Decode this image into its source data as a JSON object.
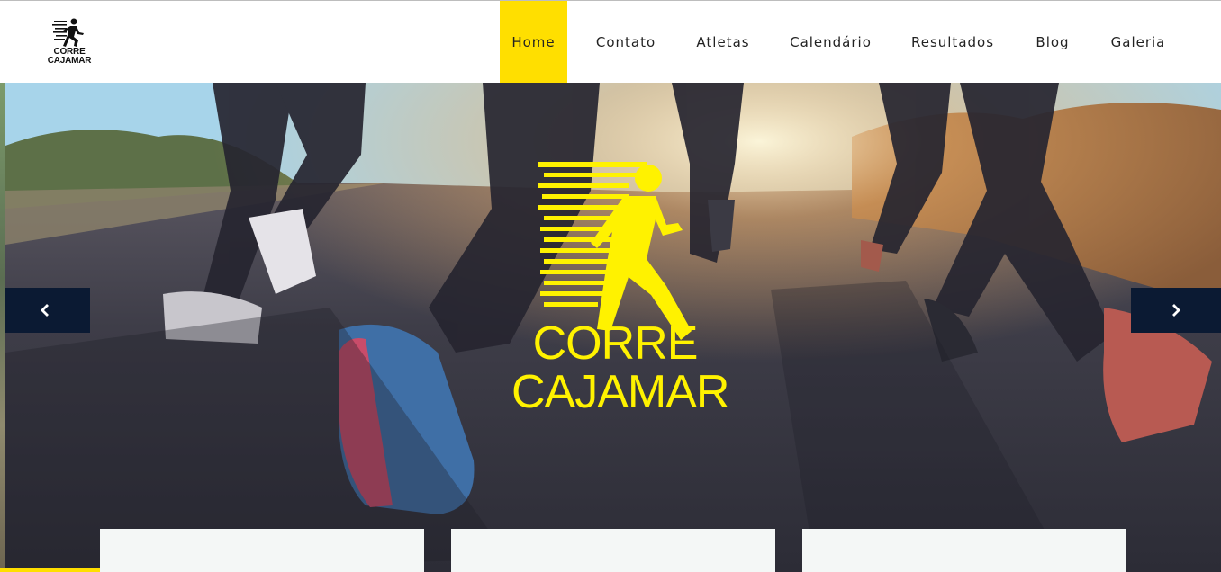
{
  "brand": {
    "name_line1": "CORRE",
    "name_line2": "CAJAMAR",
    "logo_icon": "runner-icon",
    "accent_color": "#ffdf00",
    "logo_color": "#fff200"
  },
  "nav": {
    "items": [
      {
        "label": "Home",
        "active": true
      },
      {
        "label": "Contato",
        "active": false
      },
      {
        "label": "Atletas",
        "active": false
      },
      {
        "label": "Calendário",
        "active": false
      },
      {
        "label": "Resultados",
        "active": false
      },
      {
        "label": "Blog",
        "active": false
      },
      {
        "label": "Galeria",
        "active": false
      }
    ]
  },
  "slider": {
    "prev_icon": "chevron-left-icon",
    "next_icon": "chevron-right-icon",
    "logo_line1": "CORRE",
    "logo_line2": "CAJAMAR",
    "control_color": "#0b1a33"
  }
}
